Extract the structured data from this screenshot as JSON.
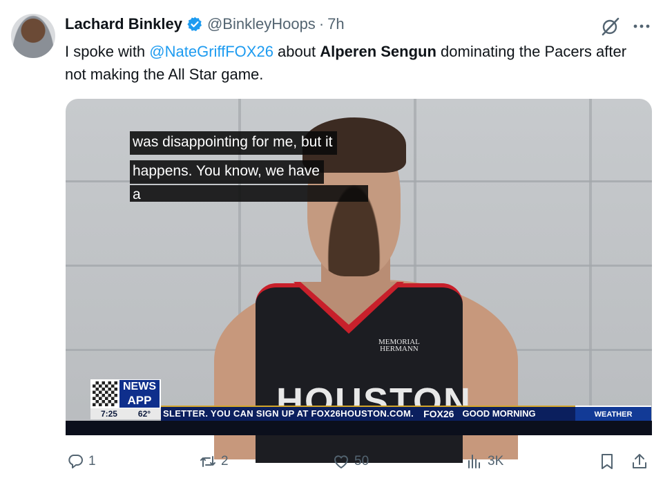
{
  "tweet": {
    "author_name": "Lachard Binkley",
    "handle": "@BinkleyHoops",
    "separator": "·",
    "time": "7h",
    "text_parts": [
      {
        "text": "I spoke with ",
        "style": "plain"
      },
      {
        "text": "@NateGriffFOX26",
        "style": "mention"
      },
      {
        "text": " about ",
        "style": "plain"
      },
      {
        "text": "Alperen Sengun",
        "style": "bold"
      },
      {
        "text": " dominating the Pacers after not making the All Star game.",
        "style": "plain"
      }
    ],
    "accent_color": "#1d9bf0"
  },
  "video": {
    "captions": [
      "was disappointing for me, but it",
      "happens. You know, we have",
      "a"
    ],
    "jersey_sponsor_line1": "MEMORIAL",
    "jersey_sponsor_line2": "HERMANN",
    "jersey_text": "HOUSTON",
    "news_label": "NEWS",
    "app_label": "APP",
    "clock_time": "7:25",
    "clock_temp": "62°",
    "ticker_text": "SLETTER. YOU CAN SIGN UP AT FOX26HOUSTON.COM.",
    "ticker_logo": "FOX26",
    "ticker_show": "GOOD MORNING",
    "weather_label": "WEATHER"
  },
  "actions": {
    "replies": "1",
    "retweets": "2",
    "likes": "50",
    "views": "3K"
  },
  "icons": [
    "verified-badge-icon",
    "grok-icon",
    "more-icon",
    "reply-icon",
    "retweet-icon",
    "like-icon",
    "views-icon",
    "bookmark-icon",
    "share-icon"
  ]
}
